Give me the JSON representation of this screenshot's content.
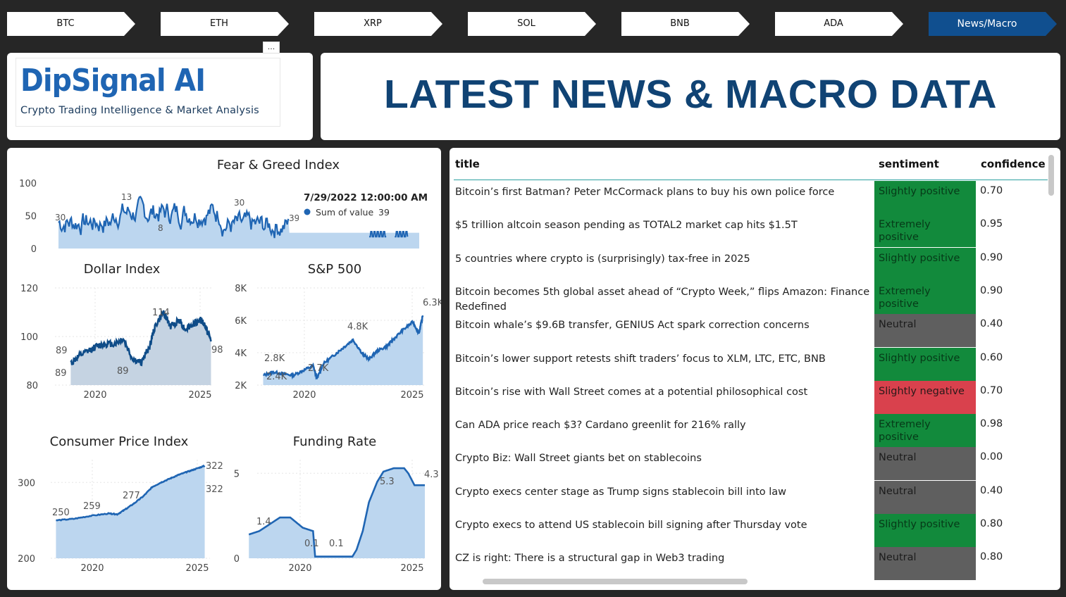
{
  "nav": {
    "tabs": [
      {
        "label": "BTC"
      },
      {
        "label": "ETH"
      },
      {
        "label": "XRP"
      },
      {
        "label": "SOL"
      },
      {
        "label": "BNB"
      },
      {
        "label": "ADA"
      },
      {
        "label": "News/Macro"
      }
    ],
    "active_index": 6
  },
  "brand": {
    "title": "DipSignal AI",
    "subtitle": "Crypto Trading Intelligence & Market Analysis",
    "more_label": "..."
  },
  "page_title": "LATEST NEWS & MACRO DATA",
  "colors": {
    "nav_bg": "#ffffff",
    "nav_active": "#104f8f",
    "brand_blue": "#1f65b3",
    "title_navy": "#104374",
    "line_blue": "#1f65b3",
    "area_fill": "#bcd6ef",
    "positive": "#128a3c",
    "neutral": "#5f5f5f",
    "negative": "#d9414d"
  },
  "chart_data": [
    {
      "type": "line",
      "title": "Fear & Greed Index",
      "yticks": [
        "0",
        "50",
        "100"
      ],
      "ylim": [
        0,
        100
      ],
      "labels": [
        "30",
        "13",
        "30",
        "8",
        "39"
      ],
      "tooltip": {
        "date": "7/29/2022 12:00:00 AM",
        "series": "Sum of value",
        "value": "39"
      }
    },
    {
      "type": "area",
      "title": "Dollar Index",
      "yticks": [
        "80",
        "100",
        "120"
      ],
      "ylim": [
        80,
        120
      ],
      "xticks": [
        "2020",
        "2025"
      ],
      "x": [
        2017.5,
        2018.0,
        2018.5,
        2019.0,
        2019.5,
        2020.0,
        2020.5,
        2021.0,
        2021.5,
        2022.0,
        2022.3,
        2022.8,
        2023.2,
        2023.7,
        2024.0,
        2024.5,
        2024.9,
        2025.2,
        2025.5
      ],
      "values": [
        89,
        92,
        94,
        96,
        97,
        97,
        99,
        91,
        89,
        96,
        104,
        110,
        104,
        107,
        103,
        105,
        107,
        104,
        98
      ],
      "labels": [
        "89",
        "89",
        "89",
        "114",
        "98"
      ]
    },
    {
      "type": "area",
      "title": "S&P 500",
      "yticks": [
        "2K",
        "4K",
        "6K",
        "8K"
      ],
      "ylim": [
        2000,
        8000
      ],
      "xticks": [
        "2020",
        "2025"
      ],
      "x": [
        2017.5,
        2018.0,
        2018.5,
        2019.0,
        2019.5,
        2020.0,
        2020.2,
        2020.5,
        2021.0,
        2021.5,
        2022.0,
        2022.5,
        2022.8,
        2023.2,
        2023.7,
        2024.0,
        2024.5,
        2025.0,
        2025.3,
        2025.5
      ],
      "values": [
        2.6,
        2.8,
        2.7,
        2.6,
        2.9,
        3.2,
        2.4,
        3.3,
        3.8,
        4.3,
        4.8,
        3.9,
        3.6,
        4.1,
        4.4,
        4.8,
        5.4,
        5.9,
        5.2,
        6.3
      ],
      "labels": [
        "2.8K",
        "2.4K",
        "2.7K",
        "4.8K",
        "6.3K"
      ]
    },
    {
      "type": "area",
      "title": "Consumer Price Index",
      "yticks": [
        "200",
        "300"
      ],
      "ylim": [
        200,
        330
      ],
      "xticks": [
        "2020",
        "2025"
      ],
      "x": [
        2017.0,
        2018.0,
        2019.0,
        2020.0,
        2020.5,
        2021.0,
        2021.5,
        2022.0,
        2022.5,
        2023.0,
        2023.5,
        2024.0,
        2024.5,
        2025.0,
        2025.5
      ],
      "values": [
        250,
        252,
        256,
        259,
        258,
        265,
        273,
        282,
        294,
        300,
        305,
        310,
        314,
        318,
        322
      ],
      "labels": [
        "250",
        "259",
        "277",
        "322",
        "322"
      ]
    },
    {
      "type": "area",
      "title": "Funding Rate",
      "yticks": [
        "0",
        "5"
      ],
      "ylim": [
        0,
        5.8
      ],
      "xticks": [
        "2020",
        "2025"
      ],
      "x": [
        2017.0,
        2017.5,
        2018.0,
        2018.5,
        2019.0,
        2019.3,
        2019.6,
        2020.1,
        2020.2,
        2021.0,
        2022.0,
        2022.2,
        2022.5,
        2022.8,
        2023.2,
        2023.5,
        2024.0,
        2024.5,
        2024.7,
        2025.0,
        2025.5
      ],
      "values": [
        1.4,
        1.6,
        2.0,
        2.4,
        2.4,
        2.1,
        1.8,
        1.6,
        0.1,
        0.1,
        0.1,
        0.5,
        1.6,
        3.3,
        4.5,
        5.1,
        5.3,
        5.3,
        5.0,
        4.3,
        4.3
      ],
      "labels": [
        "1.4",
        "0.1",
        "0.1",
        "5.3",
        "4.3"
      ]
    }
  ],
  "news": {
    "columns": [
      "title",
      "sentiment",
      "confidence"
    ],
    "rows": [
      {
        "title": "Bitcoin’s first Batman? Peter McCormack plans to buy his own police force",
        "sentiment": "Slightly positive",
        "confidence": "0.70",
        "tone": "positive"
      },
      {
        "title": "$5 trillion altcoin season pending as TOTAL2 market cap hits $1.5T",
        "sentiment": "Extremely positive",
        "confidence": "0.95",
        "tone": "positive"
      },
      {
        "title": "5 countries where crypto is (surprisingly) tax-free in 2025",
        "sentiment": "Slightly positive",
        "confidence": "0.90",
        "tone": "positive"
      },
      {
        "title": "Bitcoin becomes 5th global asset ahead of “Crypto Week,” flips Amazon: Finance Redefined",
        "sentiment": "Extremely positive",
        "confidence": "0.90",
        "tone": "positive"
      },
      {
        "title": "Bitcoin whale’s $9.6B transfer, GENIUS Act spark correction concerns",
        "sentiment": "Neutral",
        "confidence": "0.40",
        "tone": "neutral"
      },
      {
        "title": "Bitcoin’s lower support retests shift traders’ focus to XLM, LTC, ETC, BNB",
        "sentiment": "Slightly positive",
        "confidence": "0.60",
        "tone": "positive"
      },
      {
        "title": "Bitcoin’s rise with Wall Street comes at a potential philosophical cost",
        "sentiment": "Slightly negative",
        "confidence": "0.70",
        "tone": "negative"
      },
      {
        "title": "Can ADA price reach $3? Cardano greenlit for 216% rally",
        "sentiment": "Extremely positive",
        "confidence": "0.98",
        "tone": "positive"
      },
      {
        "title": "Crypto Biz: Wall Street giants bet on stablecoins",
        "sentiment": "Neutral",
        "confidence": "0.00",
        "tone": "neutral"
      },
      {
        "title": "Crypto execs center stage as Trump signs stablecoin bill into law",
        "sentiment": "Neutral",
        "confidence": "0.40",
        "tone": "neutral"
      },
      {
        "title": "Crypto execs to attend US stablecoin bill signing after Thursday vote",
        "sentiment": "Slightly positive",
        "confidence": "0.80",
        "tone": "positive"
      },
      {
        "title": "CZ is right: There is a structural gap in Web3 trading",
        "sentiment": "Neutral",
        "confidence": "0.80",
        "tone": "neutral"
      }
    ]
  }
}
